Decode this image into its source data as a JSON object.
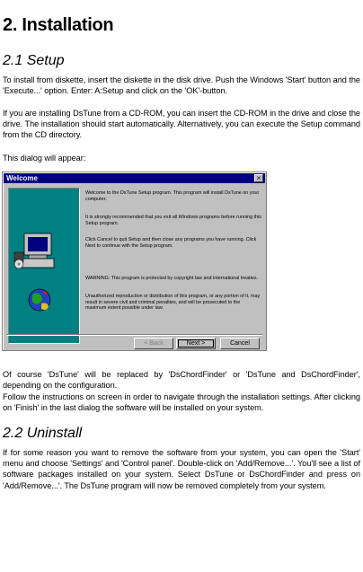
{
  "heading": "2. Installation",
  "section1": {
    "title": "2.1 Setup",
    "p1": "To install from diskette, insert the diskette in the disk drive. Push the Windows 'Start' button and the 'Execute...' option. Enter: A:Setup and click on the 'OK'-button.",
    "p2": "If you are installing DsTune from a CD-ROM, you can insert the CD-ROM in the drive and close the drive. The installation should start automatically. Alternatively, you can execute the Setup command from the CD directory.",
    "p3": "This dialog will appear:"
  },
  "dialog": {
    "title": "Welcome",
    "close": "×",
    "text1": "Welcome to the DsTune Setup program. This program will install DsTune on your computer.",
    "text2": "It is strongly recommended that you exit all Windows programs before running this Setup program.",
    "text3": "Click Cancel to quit Setup and then close any programs you have running. Click Next to continue with the Setup program.",
    "text4": "WARNING: This program is protected by copyright law and international treaties.",
    "text5": "Unauthorized reproduction or distribution of this program, or any portion of it, may result in severe civil and criminal penalties, and will be prosecuted to the maximum extent possible under law.",
    "back_label": "< Back",
    "next_label": "Next >",
    "cancel_label": "Cancel"
  },
  "after": {
    "p1": "Of course 'DsTune' will be replaced by 'DsChordFinder' or 'DsTune and DsChordFinder', depending on the configuration.",
    "p2": "Follow the instructions on screen in order to navigate through the installation settings. After clicking on 'Finish' in the last dialog the software will be installed on your system."
  },
  "section2": {
    "title": "2.2 Uninstall",
    "p1": "If for some reason you want to remove the software from your system, you can open the 'Start' menu and choose 'Settings' and 'Control panel'. Double-click on 'Add/Remove...'. You'll see a list of software packages installed on your system. Select DsTune or DsChordFinder and press on 'Add/Remove...'. The DsTune program will now be removed completely from your system."
  }
}
